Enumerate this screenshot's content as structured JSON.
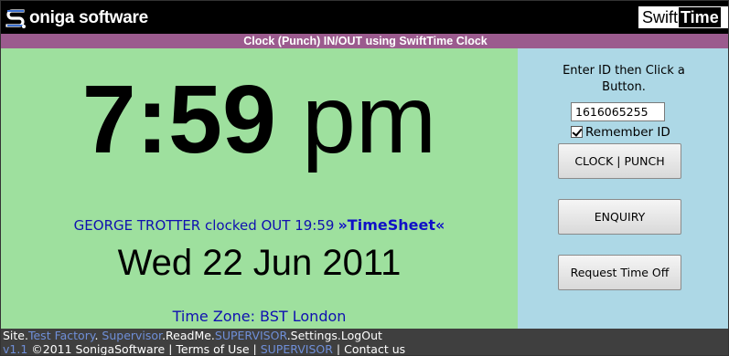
{
  "header": {
    "logo_text": "oniga software",
    "brand_swift": "Swift",
    "brand_time": "Time"
  },
  "banner": {
    "title": "Clock (Punch) IN/OUT using SwiftTime Clock"
  },
  "clock": {
    "time_hm": "7:59",
    "time_ampm": "pm",
    "status_text": "GEORGE TROTTER clocked OUT 19:59",
    "timesheet_link": "»TimeSheet«",
    "date": "Wed 22 Jun 2011",
    "timezone": "Time Zone: BST London"
  },
  "panel": {
    "instruction_line1": "Enter ID then Click a",
    "instruction_line2": "Button.",
    "id_value": "1616065255",
    "remember_label": "Remember ID",
    "remember_checked": true,
    "clock_button": "CLOCK | PUNCH",
    "enquiry_button": "ENQUIRY",
    "request_button": "Request Time Off"
  },
  "footer": {
    "nav": [
      {
        "text": "Site.",
        "style": "white"
      },
      {
        "text": "Test Factory",
        "style": "blue"
      },
      {
        "text": ". ",
        "style": "white"
      },
      {
        "text": "Supervisor",
        "style": "blue"
      },
      {
        "text": ".ReadMe.",
        "style": "white"
      },
      {
        "text": "SUPERVISOR",
        "style": "blue"
      },
      {
        "text": ".Settings.LogOut",
        "style": "white"
      }
    ],
    "version": "v1.1",
    "copyright": " ©2011 SonigaSoftware | ",
    "terms": "Terms of Use",
    "sep1": " | ",
    "supervisor": "SUPERVISOR",
    "sep2": " | ",
    "contact": "Contact us"
  },
  "colors": {
    "header_bg": "#000000",
    "banner_bg": "#9b5b8e",
    "clock_bg": "#9ee09e",
    "panel_bg": "#add8e6",
    "footer_bg": "#3f3f3f",
    "status_text": "#1010b0",
    "footer_link": "#6f8fd8"
  }
}
